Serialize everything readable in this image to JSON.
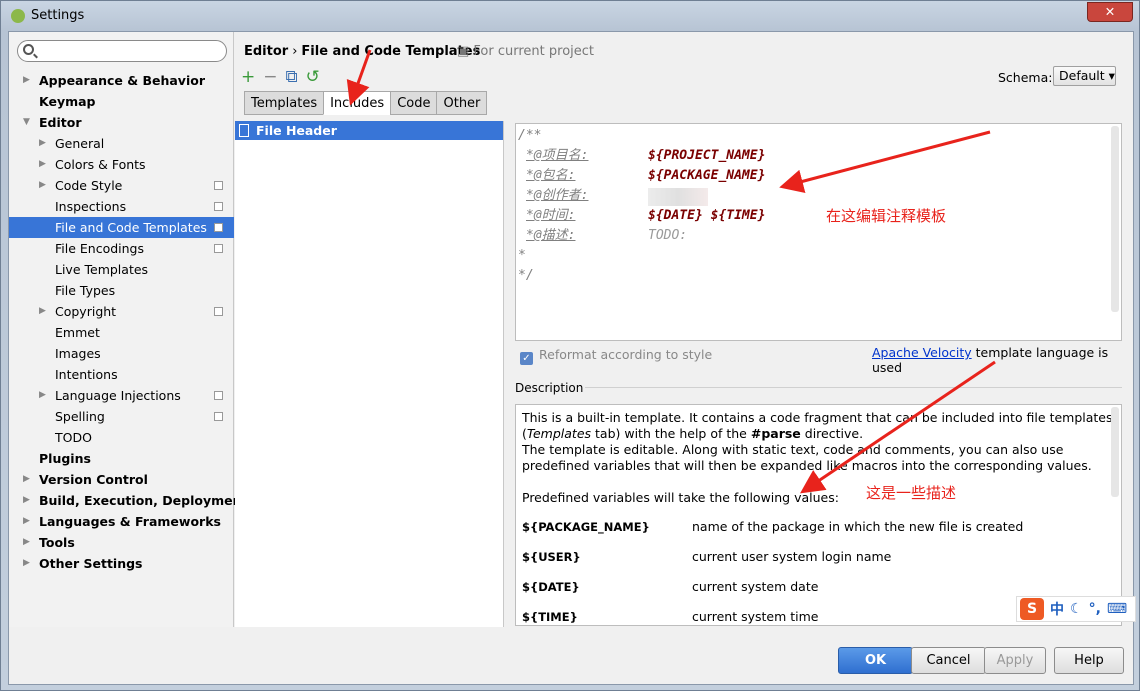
{
  "window": {
    "title": "Settings",
    "close": "✕"
  },
  "search": {
    "placeholder": ""
  },
  "sidebar": {
    "items": [
      {
        "label": "Appearance & Behavior",
        "level": 0,
        "bold": true,
        "arrow": "▶"
      },
      {
        "label": "Keymap",
        "level": 0,
        "bold": true,
        "arrow": ""
      },
      {
        "label": "Editor",
        "level": 0,
        "bold": true,
        "arrow": "▼"
      },
      {
        "label": "General",
        "level": 1,
        "arrow": "▶"
      },
      {
        "label": "Colors & Fonts",
        "level": 1,
        "arrow": "▶"
      },
      {
        "label": "Code Style",
        "level": 1,
        "arrow": "▶",
        "project": true
      },
      {
        "label": "Inspections",
        "level": 1,
        "arrow": "",
        "project": true
      },
      {
        "label": "File and Code Templates",
        "level": 1,
        "arrow": "",
        "project": true,
        "selected": true
      },
      {
        "label": "File Encodings",
        "level": 1,
        "arrow": "",
        "project": true
      },
      {
        "label": "Live Templates",
        "level": 1,
        "arrow": ""
      },
      {
        "label": "File Types",
        "level": 1,
        "arrow": ""
      },
      {
        "label": "Copyright",
        "level": 1,
        "arrow": "▶",
        "project": true
      },
      {
        "label": "Emmet",
        "level": 1,
        "arrow": ""
      },
      {
        "label": "Images",
        "level": 1,
        "arrow": ""
      },
      {
        "label": "Intentions",
        "level": 1,
        "arrow": ""
      },
      {
        "label": "Language Injections",
        "level": 1,
        "arrow": "▶",
        "project": true
      },
      {
        "label": "Spelling",
        "level": 1,
        "arrow": "",
        "project": true
      },
      {
        "label": "TODO",
        "level": 1,
        "arrow": ""
      },
      {
        "label": "Plugins",
        "level": 0,
        "bold": true,
        "arrow": ""
      },
      {
        "label": "Version Control",
        "level": 0,
        "bold": true,
        "arrow": "▶"
      },
      {
        "label": "Build, Execution, Deployment",
        "level": 0,
        "bold": true,
        "arrow": "▶"
      },
      {
        "label": "Languages & Frameworks",
        "level": 0,
        "bold": true,
        "arrow": "▶"
      },
      {
        "label": "Tools",
        "level": 0,
        "bold": true,
        "arrow": "▶"
      },
      {
        "label": "Other Settings",
        "level": 0,
        "bold": true,
        "arrow": "▶"
      }
    ]
  },
  "header": {
    "crumb1": "Editor",
    "sep": "›",
    "crumb2": "File and Code Templates",
    "for_project": "For current project"
  },
  "toolbar": {
    "add": "+",
    "remove": "−",
    "copy": "⧉",
    "reset": "↺"
  },
  "schema": {
    "label": "Schema:",
    "value": "Default ▾"
  },
  "tabs": [
    {
      "label": "Templates"
    },
    {
      "label": "Includes",
      "active": true
    },
    {
      "label": "Code"
    },
    {
      "label": "Other"
    }
  ],
  "templates": [
    {
      "label": "File Header"
    }
  ],
  "editor": {
    "lines": [
      {
        "key": "",
        "text": "/**"
      },
      {
        "key": "*@项目名:",
        "value": "${PROJECT_NAME}"
      },
      {
        "key": "*@包名:",
        "value": "${PACKAGE_NAME}"
      },
      {
        "key": "*@创作者:",
        "value": ""
      },
      {
        "key": "*@时间:",
        "value": "${DATE} ${TIME}"
      },
      {
        "key": "*@描述:",
        "todo": "TODO:"
      },
      {
        "key": "",
        "text": " *"
      },
      {
        "key": "",
        "text": " */"
      }
    ]
  },
  "reformat": {
    "label": "Reformat according to style",
    "checked": true
  },
  "velocity": {
    "link": "Apache Velocity",
    "text": " template language is used"
  },
  "description": {
    "label": "Description",
    "p1a": "This is a built-in template. It contains a code fragment that can be included into file templates (",
    "p1i": "Templates",
    "p1b": " tab) with the help of the ",
    "p1c": "#parse",
    "p1d": " directive.",
    "p2": "The template is editable. Along with static text, code and comments, you can also use predefined variables that will then be expanded like macros into the corresponding values.",
    "p3": "Predefined variables will take the following values:",
    "vars": [
      {
        "name": "${PACKAGE_NAME}",
        "desc": "name of the package in which the new file is created"
      },
      {
        "name": "${USER}",
        "desc": "current user system login name"
      },
      {
        "name": "${DATE}",
        "desc": "current system date"
      },
      {
        "name": "${TIME}",
        "desc": "current system time"
      }
    ]
  },
  "buttons": {
    "ok": "OK",
    "cancel": "Cancel",
    "apply": "Apply",
    "help": "Help"
  },
  "annotations": {
    "edit": "在这编辑注释模板",
    "desc": "这是一些描述",
    "color": "#e8231c"
  },
  "ime": {
    "logo": "S",
    "mode": "中",
    "moon": "☾",
    "punct": "°,",
    "keyboard": "⌨"
  }
}
